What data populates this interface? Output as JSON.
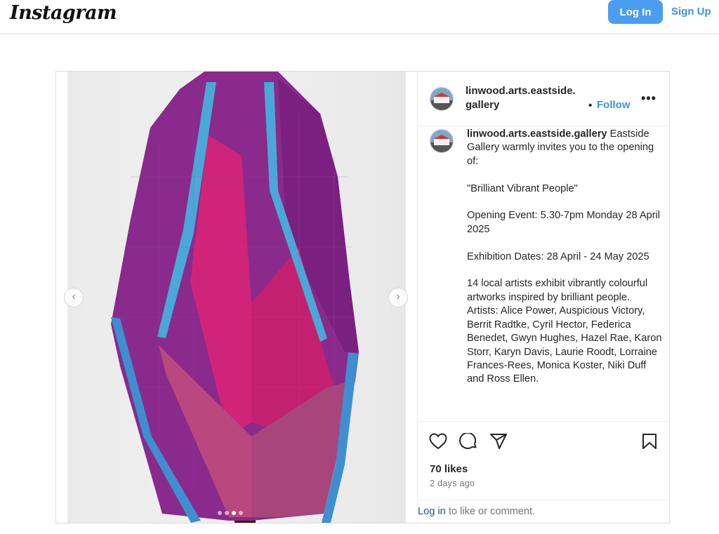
{
  "header": {
    "logo": "Instagram",
    "login_label": "Log In",
    "signup_label": "Sign Up"
  },
  "post": {
    "username_line1": "linwood.arts.eastside.",
    "username_line2": "gallery",
    "follow_separator": "•",
    "follow_label": "Follow",
    "more_label": "•••",
    "caption": {
      "username": "linwood.arts.eastside.gallery",
      "text": " Eastside Gallery warmly invites you to the opening of:\n\n\"Brilliant Vibrant People\"\n\nOpening Event: 5.30-7pm Monday 28 April 2025\n\nExhibition Dates: 28 April - 24 May 2025\n\n14 local artists exhibit vibrantly colourful artworks inspired by brilliant people. Artists: Alice Power, Auspicious Victory, Berrit Radtke, Cyril Hector, Federica Benedet, Gwyn Hughes, Hazel Rae, Karon Storr, Karyn Davis, Laurie Roodt, Lorraine Frances-Rees, Monica Koster, Niki Duff and Ross Ellen."
    },
    "likes": "70 likes",
    "time": "2 days ago",
    "login_prompt": {
      "link": "Log in",
      "rest": " to like or comment."
    },
    "carousel": {
      "prev_icon": "chevron-left-icon",
      "next_icon": "chevron-right-icon",
      "count": 4,
      "active_index": 2
    }
  },
  "colors": {
    "accent": "#4a9df0",
    "link": "#3a92e8",
    "shawl_purple": "#8a2a8c",
    "shawl_pink": "#d02478",
    "shawl_blue": "#4aa8d8"
  }
}
